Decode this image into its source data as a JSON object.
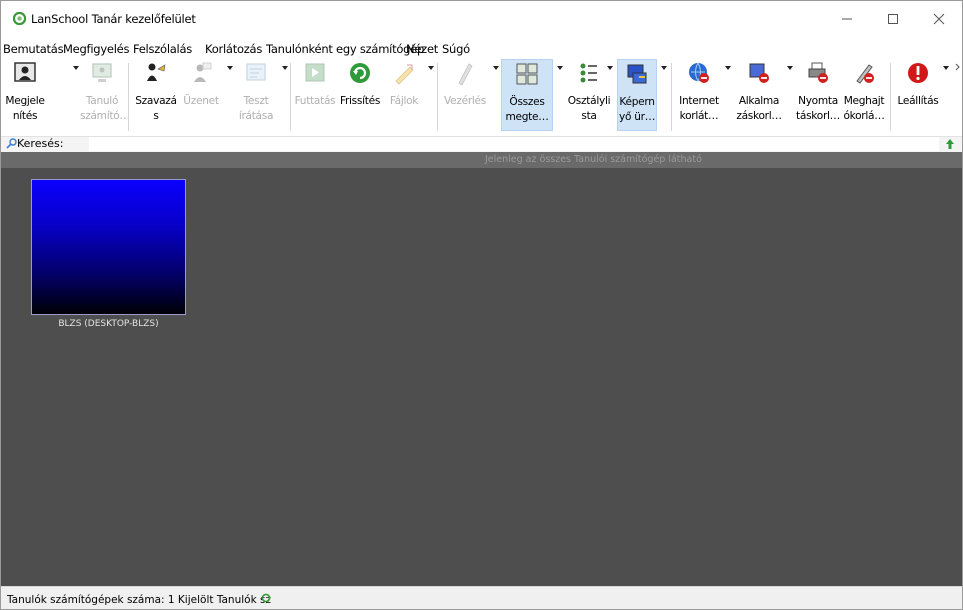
{
  "window": {
    "title": "LanSchool Tanár kezelőfelület"
  },
  "menu": [
    "Bemutatás",
    "Megfigyelés",
    "Felszólalás",
    "Korlátozás",
    "Tanulónként egy számítógép",
    "Nézet",
    "Súgó"
  ],
  "toolbar": {
    "buttons": [
      {
        "line1": "Megjele",
        "line2": "nítés",
        "icon": "presentation-icon",
        "enabled": true,
        "dropdown": true
      },
      {
        "line1": "Tanuló",
        "line2": "számító…",
        "icon": "student-pc-icon",
        "enabled": false,
        "dropdown": false
      },
      {
        "line1": "Szavazá",
        "line2": "s",
        "icon": "vote-icon",
        "enabled": true,
        "dropdown": false
      },
      {
        "line1": "Üzenet",
        "line2": "",
        "icon": "message-icon",
        "enabled": false,
        "dropdown": true
      },
      {
        "line1": "Teszt",
        "line2": "írátása",
        "icon": "test-icon",
        "enabled": false,
        "dropdown": true
      },
      {
        "line1": "Futtatás",
        "line2": "",
        "icon": "run-icon",
        "enabled": false,
        "dropdown": false
      },
      {
        "line1": "Frissítés",
        "line2": "",
        "icon": "refresh-icon",
        "enabled": true,
        "dropdown": false
      },
      {
        "line1": "Fájlok",
        "line2": "",
        "icon": "files-icon",
        "enabled": false,
        "dropdown": true
      },
      {
        "line1": "Vezérlés",
        "line2": "",
        "icon": "control-icon",
        "enabled": false,
        "dropdown": true
      },
      {
        "line1": "Összes",
        "line2": "megte…",
        "icon": "all-screens-icon",
        "enabled": true,
        "dropdown": true,
        "active": true
      },
      {
        "line1": "Osztályli",
        "line2": "sta",
        "icon": "class-list-icon",
        "enabled": true,
        "dropdown": false
      },
      {
        "line1": "Képern",
        "line2": "yő ür…",
        "icon": "blank-screen-icon",
        "enabled": true,
        "dropdown": true,
        "active": true
      },
      {
        "line1": "Internet",
        "line2": "korlát…",
        "icon": "internet-limit-icon",
        "enabled": true,
        "dropdown": true
      },
      {
        "line1": "Alkalma",
        "line2": "záskorl…",
        "icon": "app-limit-icon",
        "enabled": true,
        "dropdown": true
      },
      {
        "line1": "Nyomta",
        "line2": "táskorl…",
        "icon": "printer-limit-icon",
        "enabled": true,
        "dropdown": false
      },
      {
        "line1": "Meghajt",
        "line2": "ókorlá…",
        "icon": "drive-limit-icon",
        "enabled": true,
        "dropdown": false
      },
      {
        "line1": "Leállítás",
        "line2": "",
        "icon": "shutdown-icon",
        "enabled": true,
        "dropdown": true
      }
    ]
  },
  "search": {
    "label": "Keresés:",
    "value": ""
  },
  "filter_text": "Jelenleg az összes Tanulói számítógép látható",
  "students": [
    {
      "name": "BLZS (DESKTOP-BLZS)"
    }
  ],
  "status": {
    "text": "Tanulók számítógépek száma: 1  Kijelölt Tanulók sz"
  }
}
